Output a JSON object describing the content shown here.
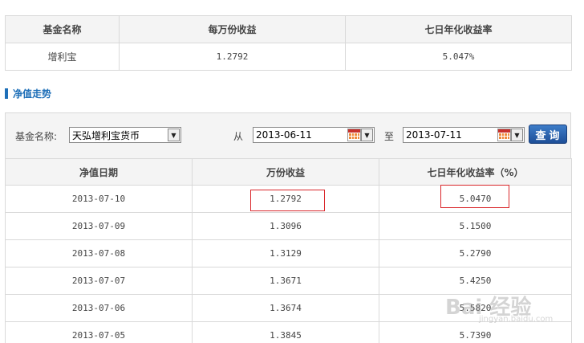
{
  "summary": {
    "headers": [
      "基金名称",
      "每万份收益",
      "七日年化收益率"
    ],
    "row": {
      "name": "增利宝",
      "income": "1.2792",
      "rate": "5.047%"
    }
  },
  "section_title": "净值走势",
  "filter": {
    "fund_label": "基金名称:",
    "fund_selected": "天弘增利宝货币",
    "from_label": "从",
    "from_date": "2013-06-11",
    "to_label": "至",
    "to_date": "2013-07-11",
    "query_button": "查询"
  },
  "nav_table": {
    "headers": [
      "净值日期",
      "万份收益",
      "七日年化收益率（%）"
    ],
    "rows": [
      {
        "date": "2013-07-10",
        "income": "1.2792",
        "rate": "5.0470"
      },
      {
        "date": "2013-07-09",
        "income": "1.3096",
        "rate": "5.1500"
      },
      {
        "date": "2013-07-08",
        "income": "1.3129",
        "rate": "5.2790"
      },
      {
        "date": "2013-07-07",
        "income": "1.3671",
        "rate": "5.4250"
      },
      {
        "date": "2013-07-06",
        "income": "1.3674",
        "rate": "5.5820"
      },
      {
        "date": "2013-07-05",
        "income": "1.3845",
        "rate": "5.7390"
      }
    ]
  },
  "watermark": {
    "main": "Bai 经验",
    "sub": "jingyan.baidu.com"
  },
  "colors": {
    "accent": "#1e6fb8",
    "highlight": "#d9262a",
    "button": "#2a5fa8"
  }
}
